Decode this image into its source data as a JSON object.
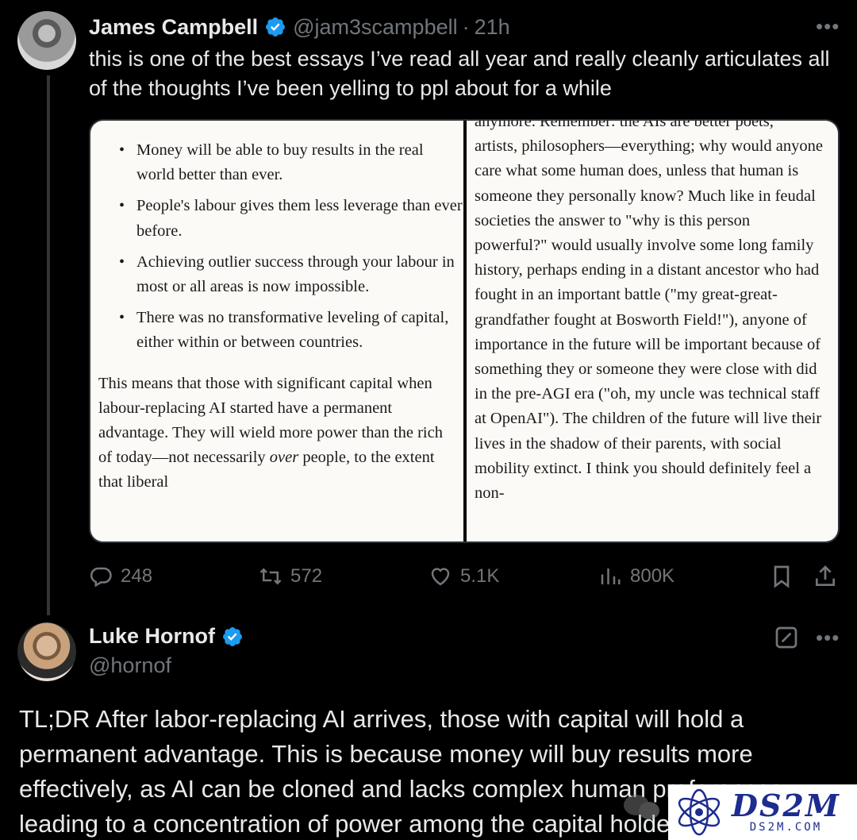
{
  "tweet1": {
    "author_name": "James Campbell",
    "handle": "@jam3scampbell",
    "separator": "·",
    "time": "21h",
    "more_label": "•••",
    "text": "this is one of the best essays I’ve read all year and really cleanly articulates all of the thoughts I’ve been yelling to ppl about for a while",
    "image": {
      "left_bullets": [
        "Money will be able to buy results in the real world better than ever.",
        "People's labour gives them less leverage than ever before.",
        "Achieving outlier success through your labour in most or all areas is now impossible.",
        "There was no transformative leveling of capital, either within or between countries."
      ],
      "left_para_before": "This means that those with significant capital when labour-replacing AI started have a permanent advantage. They will wield more power than the rich of today—not necessarily ",
      "left_para_italic": "over",
      "left_para_after": " people, to the extent that liberal",
      "right_cut_line": "anymore. Remember: the AIs are better poets,",
      "right_text": "artists, philosophers—everything; why would anyone care what some human does, unless that human is someone they personally know? Much like in feudal societies the answer to \"why is this person powerful?\" would usually involve some long family history, perhaps ending in a distant ancestor who had fought in an important battle (\"my great-great-grandfather fought at Bosworth Field!\"), anyone of importance in the future will be important because of something they or someone they were close with did in the pre-AGI era (\"oh, my uncle was technical staff at OpenAI\"). The children of the future will live their lives in the shadow of their parents, with social mobility extinct. I think you should definitely feel a non-"
    },
    "actions": {
      "replies": "248",
      "reposts": "572",
      "likes": "5.1K",
      "views": "800K"
    }
  },
  "tweet2": {
    "author_name": "Luke Hornof",
    "handle": "@hornof",
    "more_label": "•••",
    "text": "TL;DR After labor-replacing AI arrives, those with capital will hold a permanent advantage. This is because money will buy results more effectively, as AI can be cloned and lacks complex human preferences, leading to a concentration of power among the capital holders."
  },
  "watermark": {
    "logo": "DS2M",
    "sub": "DS2M.COM"
  },
  "colors": {
    "background": "#000000",
    "text": "#e7e9ea",
    "muted": "#71767b",
    "verified": "#1d9bf0",
    "thread_line": "#333639"
  }
}
